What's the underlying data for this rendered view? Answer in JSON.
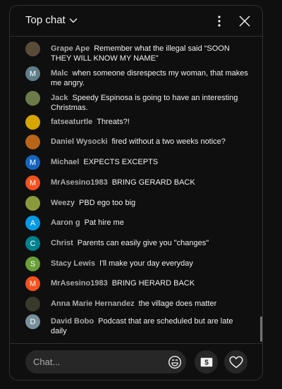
{
  "header": {
    "title": "Top chat"
  },
  "input": {
    "placeholder": "Chat..."
  },
  "icons": {
    "chevron": "chevron-down-icon",
    "more": "more-vert-icon",
    "close": "close-icon",
    "emoji": "emoji-icon",
    "super_chat": "dollar-icon",
    "heart": "heart-icon"
  },
  "messages": [
    {
      "author": "Grape Ape",
      "text": "Remember what the illegal said “SOON THEY WILL KNOW MY NAME”",
      "avatar": "",
      "avatar_color": "#5a4a3a"
    },
    {
      "author": "Malc",
      "text": "when someone disrespects my woman, that makes me angry.",
      "avatar": "M",
      "avatar_color": "#607d8b"
    },
    {
      "author": "Jack",
      "text": "Speedy Espinosa is going to have an interesting Christmas.",
      "avatar": "",
      "avatar_color": "#6b7b4a"
    },
    {
      "author": "fatseaturtle",
      "text": "Threats?!",
      "avatar": "",
      "avatar_color": "#d8a400"
    },
    {
      "author": "Daniel Wysocki",
      "text": "fired without a two weeks notice?",
      "avatar": "",
      "avatar_color": "#b8651a"
    },
    {
      "author": "Michael",
      "text": "EXPECTS EXCEPTS",
      "avatar": "M",
      "avatar_color": "#1565c0"
    },
    {
      "author": "MrAsesino1983",
      "text": "BRING GERARD BACK",
      "avatar": "M",
      "avatar_color": "#f4511e"
    },
    {
      "author": "Weezy",
      "text": "PBD ego too big",
      "avatar": "",
      "avatar_color": "#8a9a3a"
    },
    {
      "author": "Aaron g",
      "text": "Pat hire me",
      "avatar": "A",
      "avatar_color": "#039be5"
    },
    {
      "author": "Christ",
      "text": "Parents can easily give you \"changes\"",
      "avatar": "C",
      "avatar_color": "#00838f"
    },
    {
      "author": "Stacy Lewis",
      "text": "I'll make your day everyday",
      "avatar": "S",
      "avatar_color": "#689f38"
    },
    {
      "author": "MrAsesino1983",
      "text": "BRING HERARD BACK",
      "avatar": "M",
      "avatar_color": "#f4511e"
    },
    {
      "author": "Anna Marie Hernandez",
      "text": "the village does matter",
      "avatar": "",
      "avatar_color": "#3a3a2a"
    },
    {
      "author": "David Bobo",
      "text": "Podcast that are scheduled but are late daily",
      "avatar": "D",
      "avatar_color": "#78909c"
    }
  ]
}
